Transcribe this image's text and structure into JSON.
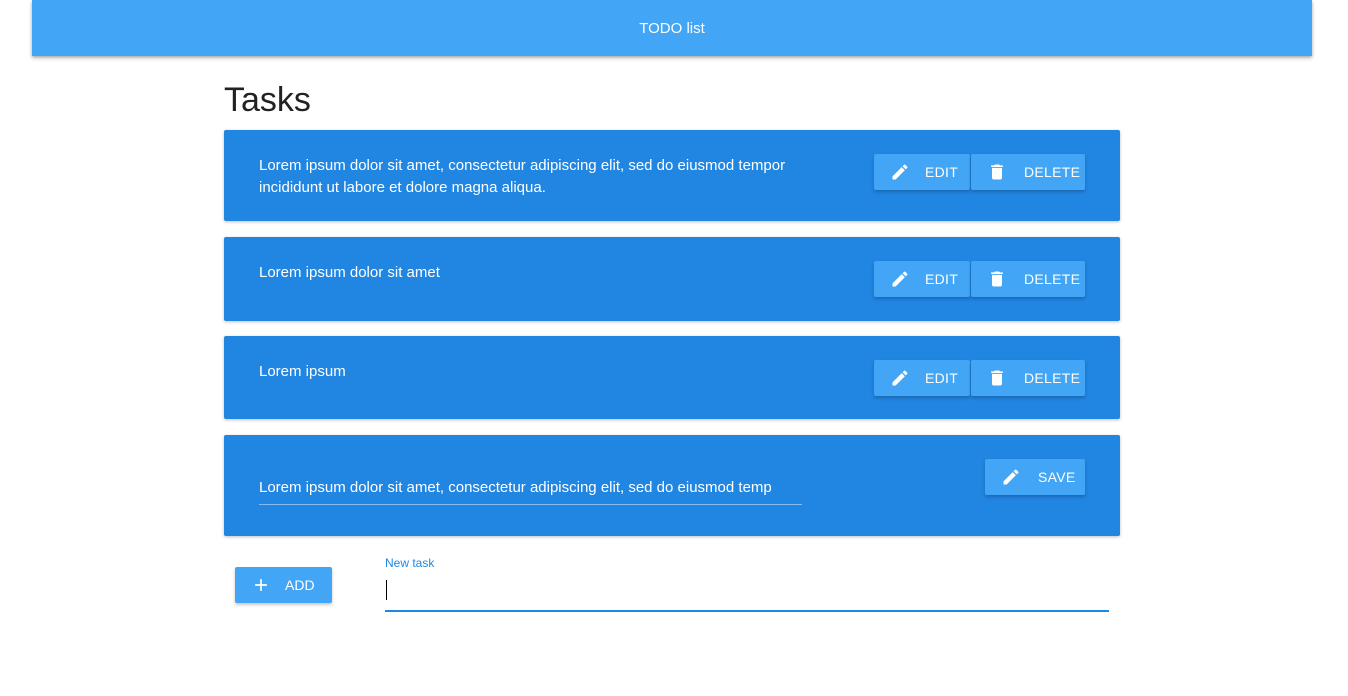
{
  "app": {
    "title": "TODO list"
  },
  "page": {
    "heading": "Tasks"
  },
  "tasks": [
    {
      "text": "Lorem ipsum dolor sit amet, consectetur adipiscing elit, sed do eiusmod tempor incididunt ut labore et dolore magna aliqua.",
      "edit_label": "EDIT",
      "delete_label": "DELETE"
    },
    {
      "text": "Lorem ipsum dolor sit amet",
      "edit_label": "EDIT",
      "delete_label": "DELETE"
    },
    {
      "text": "Lorem ipsum",
      "edit_label": "EDIT",
      "delete_label": "DELETE"
    }
  ],
  "editing_task": {
    "value": "Lorem ipsum dolor sit amet, consectetur adipiscing elit, sed do eiusmod temp",
    "save_label": "SAVE"
  },
  "new_task": {
    "add_label": "ADD",
    "field_label": "New task",
    "value": ""
  },
  "icons": {
    "edit": "pencil-icon",
    "delete": "trash-icon",
    "save": "pencil-icon",
    "add": "plus-icon"
  },
  "colors": {
    "appbar": "#42a5f5",
    "card": "#2185e2",
    "button": "#42a5f5",
    "input_accent": "#1e88e5"
  }
}
